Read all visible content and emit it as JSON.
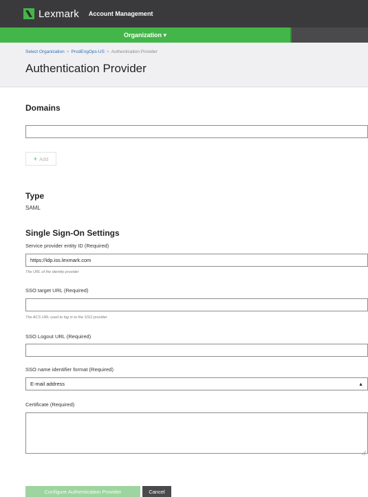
{
  "topbar": {
    "brand": "Lexmark",
    "app_title": "Account Management",
    "logo_color": "#43b649"
  },
  "nav": {
    "organization_menu": "Organization ▾",
    "accent": "#43b649"
  },
  "breadcrumb": {
    "items": [
      "Select Organization",
      "ProdEngOps-US",
      "Authentication Provider"
    ],
    "separator": ">"
  },
  "page": {
    "title": "Authentication Provider"
  },
  "domains": {
    "heading": "Domains",
    "input_value": "",
    "add_label": "Add"
  },
  "type": {
    "heading": "Type",
    "value": "SAML"
  },
  "sso": {
    "heading": "Single Sign-On Settings",
    "entity_id_label": "Service provider entity ID (Required)",
    "entity_id_value": "https://idp.iss.lexmark.com",
    "entity_id_hint": "The URL of the identity provider",
    "target_url_label": "SSO target URL (Required)",
    "target_url_value": "",
    "target_url_hint": "The ACS URL used to log in to the SSO provider",
    "logout_url_label": "SSO Logout URL (Required)",
    "logout_url_value": "",
    "name_id_label": "SSO name identifier format (Required)",
    "name_id_selected": "E-mail address",
    "certificate_label": "Certificate (Required)",
    "certificate_value": ""
  },
  "actions": {
    "configure_label": "Configure Authentication Provider",
    "cancel_label": "Cancel"
  }
}
